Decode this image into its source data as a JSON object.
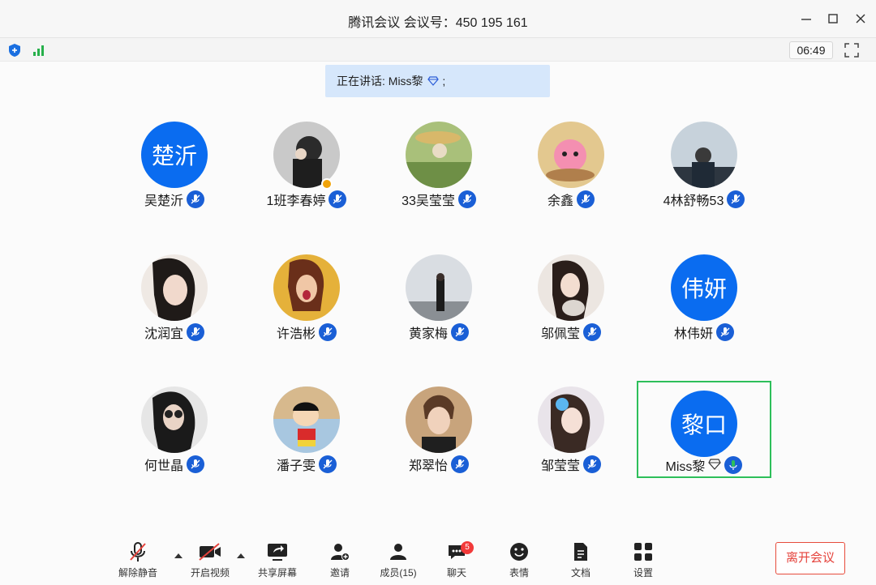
{
  "window": {
    "title": "腾讯会议 会议号：450 195 161"
  },
  "status": {
    "time": "06:49"
  },
  "speaking": {
    "prefix": "正在讲话: ",
    "name": "Miss黎",
    "suffix": ";"
  },
  "participants": [
    {
      "name": "吴楚沂",
      "avatar_text": "楚沂"
    },
    {
      "name": "1班李春婷"
    },
    {
      "name": "33吴莹莹"
    },
    {
      "name": "余鑫"
    },
    {
      "name": "4林舒畅53"
    },
    {
      "name": "沈润宜"
    },
    {
      "name": "许浩彬"
    },
    {
      "name": "黄家梅"
    },
    {
      "name": "邬佩莹"
    },
    {
      "name": "林伟妍",
      "avatar_text": "伟妍"
    },
    {
      "name": "何世晶"
    },
    {
      "name": "潘子雯"
    },
    {
      "name": "郑翠怡"
    },
    {
      "name": "邹莹莹"
    },
    {
      "name": "Miss黎",
      "avatar_text": "黎口"
    }
  ],
  "toolbar": {
    "unmute": "解除静音",
    "start_video": "开启视频",
    "share_screen": "共享屏幕",
    "invite": "邀请",
    "members": "成员(15)",
    "chat": "聊天",
    "chat_badge": "5",
    "reactions": "表情",
    "docs": "文档",
    "settings": "设置",
    "leave": "离开会议"
  },
  "colors": {
    "accent": "#0a6cf0",
    "active_border": "#2dbf5a",
    "leave": "#e5423b",
    "mic": "#1a5fd6"
  }
}
